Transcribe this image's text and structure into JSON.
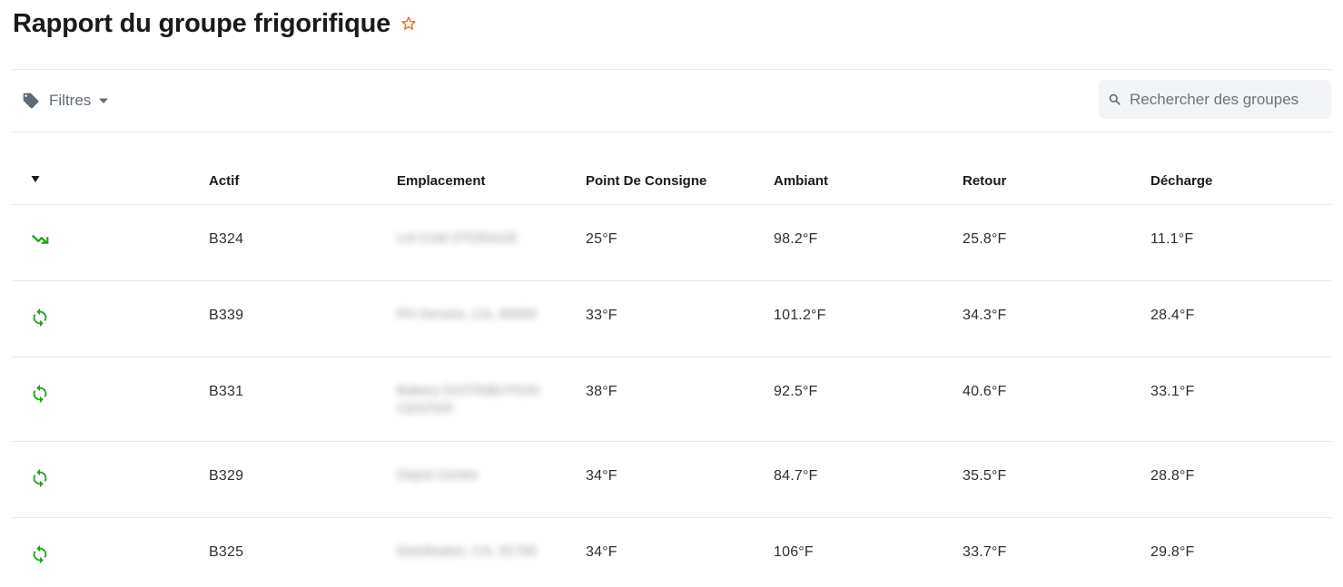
{
  "header": {
    "title": "Rapport du groupe frigorifique",
    "favorite_icon": "star-outline-icon",
    "favorite_color": "#e8742a"
  },
  "toolbar": {
    "filters_label": "Filtres",
    "filters_icon": "tag-icon",
    "search_placeholder": "Rechercher des groupes",
    "search_icon": "search-icon"
  },
  "table": {
    "sort_icon": "sort-desc-icon",
    "columns": [
      "Actif",
      "Emplacement",
      "Point De Consigne",
      "Ambiant",
      "Retour",
      "Décharge"
    ],
    "rows": [
      {
        "status_icon": "trending-down-icon",
        "asset": "B324",
        "location": "Lot Cold STORAGE",
        "setpoint": "25°F",
        "ambient": "98.2°F",
        "return": "25.8°F",
        "discharge": "11.1°F"
      },
      {
        "status_icon": "refresh-icon",
        "asset": "B339",
        "location": "PH Service, CA, 90000",
        "setpoint": "33°F",
        "ambient": "101.2°F",
        "return": "34.3°F",
        "discharge": "28.4°F"
      },
      {
        "status_icon": "refresh-icon",
        "asset": "B331",
        "location": "Bakery DISTRIBUTION CENTER",
        "setpoint": "38°F",
        "ambient": "92.5°F",
        "return": "40.6°F",
        "discharge": "33.1°F"
      },
      {
        "status_icon": "refresh-icon",
        "asset": "B329",
        "location": "Depot Centre",
        "setpoint": "34°F",
        "ambient": "84.7°F",
        "return": "35.5°F",
        "discharge": "28.8°F"
      },
      {
        "status_icon": "refresh-icon",
        "asset": "B325",
        "location": "Distribution, CA, 91760",
        "setpoint": "34°F",
        "ambient": "106°F",
        "return": "33.7°F",
        "discharge": "29.8°F"
      }
    ]
  },
  "colors": {
    "status_green": "#1aa51a",
    "icon_gray": "#5f6b76"
  }
}
